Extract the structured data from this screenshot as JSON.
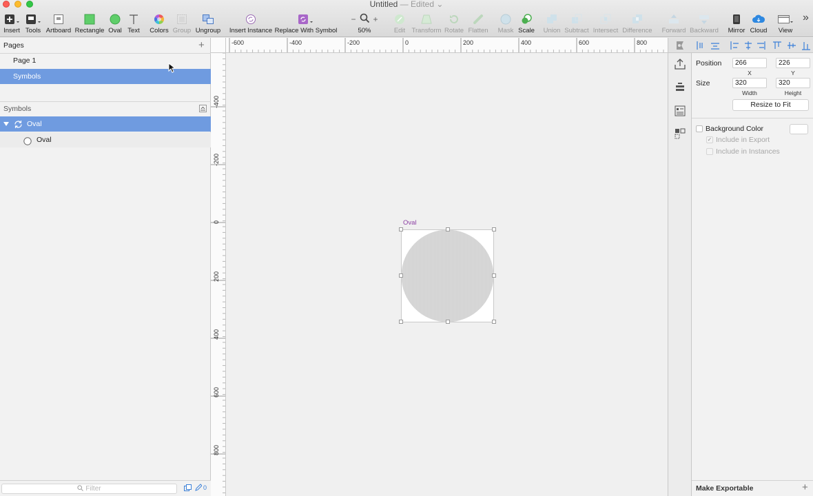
{
  "window": {
    "title": "Untitled",
    "edited_suffix": "— Edited ⌄"
  },
  "toolbar": {
    "insert": "Insert",
    "tools": "Tools",
    "artboard": "Artboard",
    "rectangle": "Rectangle",
    "oval": "Oval",
    "text": "Text",
    "colors": "Colors",
    "group": "Group",
    "ungroup": "Ungroup",
    "insert_instance": "Insert Instance",
    "replace_with_symbol": "Replace With Symbol",
    "zoom_value": "50%",
    "zoom_minus": "−",
    "zoom_plus": "+",
    "edit": "Edit",
    "transform": "Transform",
    "rotate": "Rotate",
    "flatten": "Flatten",
    "mask": "Mask",
    "scale": "Scale",
    "union": "Union",
    "subtract": "Subtract",
    "intersect": "Intersect",
    "difference": "Difference",
    "forward": "Forward",
    "backward": "Backward",
    "mirror": "Mirror",
    "cloud": "Cloud",
    "view": "View",
    "overflow": "»"
  },
  "pages_panel": {
    "title": "Pages",
    "add": "+",
    "items": [
      {
        "label": "Page 1",
        "selected": false
      },
      {
        "label": "Symbols",
        "selected": true
      }
    ]
  },
  "layers_panel": {
    "title": "Symbols",
    "items": [
      {
        "label": "Oval",
        "type": "symbol-master",
        "selected": true
      },
      {
        "label": "Oval",
        "type": "oval",
        "selected": false
      }
    ]
  },
  "filter": {
    "placeholder": "Filter",
    "count": "0"
  },
  "ruler": {
    "h_labels": [
      "-600",
      "-400",
      "-200",
      "0",
      "200",
      "400",
      "600",
      "800"
    ],
    "v_labels": [
      "-400",
      "-200",
      "0",
      "200",
      "400",
      "600",
      "800"
    ]
  },
  "canvas": {
    "artboard_label": "Oval"
  },
  "inspector": {
    "position_label": "Position",
    "x_value": "266",
    "y_value": "226",
    "x_label": "X",
    "y_label": "Y",
    "size_label": "Size",
    "width_value": "320",
    "height_value": "320",
    "width_label": "Width",
    "height_label": "Height",
    "resize_to_fit": "Resize to Fit",
    "background_color": "Background Color",
    "include_in_export": "Include in Export",
    "include_in_instances": "Include in Instances",
    "make_exportable": "Make Exportable",
    "make_exportable_add": "+"
  },
  "colors": {
    "selection": "#6f9be0",
    "symbol_purple": "#8b3fa3"
  }
}
